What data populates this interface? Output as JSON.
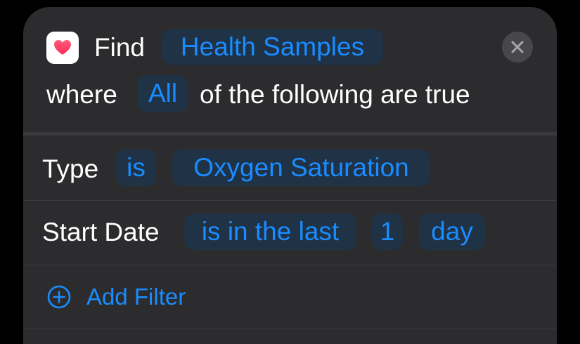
{
  "header": {
    "find_label": "Find",
    "entity_token": "Health Samples",
    "where_label": "where",
    "match_token": "All",
    "condition_suffix": "of the following are true",
    "app_icon": "health-heart-icon",
    "close_icon": "close-icon"
  },
  "filters": [
    {
      "field": "Type",
      "operator": "is",
      "value": "Oxygen Saturation"
    },
    {
      "field": "Start Date",
      "operator": "is in the last",
      "amount": "1",
      "unit": "day"
    }
  ],
  "add_filter": {
    "label": "Add Filter",
    "icon": "plus-circle-icon"
  },
  "colors": {
    "background": "#000000",
    "card": "#2c2c2e",
    "token_bg": "#1f3246",
    "accent": "#1a8cff",
    "heart": "#ff2d55"
  }
}
